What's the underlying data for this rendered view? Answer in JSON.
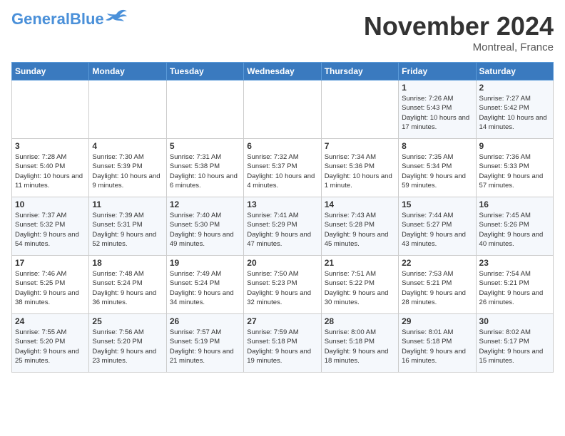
{
  "header": {
    "logo_general": "General",
    "logo_blue": "Blue",
    "month_title": "November 2024",
    "location": "Montreal, France"
  },
  "days_of_week": [
    "Sunday",
    "Monday",
    "Tuesday",
    "Wednesday",
    "Thursday",
    "Friday",
    "Saturday"
  ],
  "weeks": [
    [
      {
        "day": "",
        "info": ""
      },
      {
        "day": "",
        "info": ""
      },
      {
        "day": "",
        "info": ""
      },
      {
        "day": "",
        "info": ""
      },
      {
        "day": "",
        "info": ""
      },
      {
        "day": "1",
        "info": "Sunrise: 7:26 AM\nSunset: 5:43 PM\nDaylight: 10 hours and 17 minutes."
      },
      {
        "day": "2",
        "info": "Sunrise: 7:27 AM\nSunset: 5:42 PM\nDaylight: 10 hours and 14 minutes."
      }
    ],
    [
      {
        "day": "3",
        "info": "Sunrise: 7:28 AM\nSunset: 5:40 PM\nDaylight: 10 hours and 11 minutes."
      },
      {
        "day": "4",
        "info": "Sunrise: 7:30 AM\nSunset: 5:39 PM\nDaylight: 10 hours and 9 minutes."
      },
      {
        "day": "5",
        "info": "Sunrise: 7:31 AM\nSunset: 5:38 PM\nDaylight: 10 hours and 6 minutes."
      },
      {
        "day": "6",
        "info": "Sunrise: 7:32 AM\nSunset: 5:37 PM\nDaylight: 10 hours and 4 minutes."
      },
      {
        "day": "7",
        "info": "Sunrise: 7:34 AM\nSunset: 5:36 PM\nDaylight: 10 hours and 1 minute."
      },
      {
        "day": "8",
        "info": "Sunrise: 7:35 AM\nSunset: 5:34 PM\nDaylight: 9 hours and 59 minutes."
      },
      {
        "day": "9",
        "info": "Sunrise: 7:36 AM\nSunset: 5:33 PM\nDaylight: 9 hours and 57 minutes."
      }
    ],
    [
      {
        "day": "10",
        "info": "Sunrise: 7:37 AM\nSunset: 5:32 PM\nDaylight: 9 hours and 54 minutes."
      },
      {
        "day": "11",
        "info": "Sunrise: 7:39 AM\nSunset: 5:31 PM\nDaylight: 9 hours and 52 minutes."
      },
      {
        "day": "12",
        "info": "Sunrise: 7:40 AM\nSunset: 5:30 PM\nDaylight: 9 hours and 49 minutes."
      },
      {
        "day": "13",
        "info": "Sunrise: 7:41 AM\nSunset: 5:29 PM\nDaylight: 9 hours and 47 minutes."
      },
      {
        "day": "14",
        "info": "Sunrise: 7:43 AM\nSunset: 5:28 PM\nDaylight: 9 hours and 45 minutes."
      },
      {
        "day": "15",
        "info": "Sunrise: 7:44 AM\nSunset: 5:27 PM\nDaylight: 9 hours and 43 minutes."
      },
      {
        "day": "16",
        "info": "Sunrise: 7:45 AM\nSunset: 5:26 PM\nDaylight: 9 hours and 40 minutes."
      }
    ],
    [
      {
        "day": "17",
        "info": "Sunrise: 7:46 AM\nSunset: 5:25 PM\nDaylight: 9 hours and 38 minutes."
      },
      {
        "day": "18",
        "info": "Sunrise: 7:48 AM\nSunset: 5:24 PM\nDaylight: 9 hours and 36 minutes."
      },
      {
        "day": "19",
        "info": "Sunrise: 7:49 AM\nSunset: 5:24 PM\nDaylight: 9 hours and 34 minutes."
      },
      {
        "day": "20",
        "info": "Sunrise: 7:50 AM\nSunset: 5:23 PM\nDaylight: 9 hours and 32 minutes."
      },
      {
        "day": "21",
        "info": "Sunrise: 7:51 AM\nSunset: 5:22 PM\nDaylight: 9 hours and 30 minutes."
      },
      {
        "day": "22",
        "info": "Sunrise: 7:53 AM\nSunset: 5:21 PM\nDaylight: 9 hours and 28 minutes."
      },
      {
        "day": "23",
        "info": "Sunrise: 7:54 AM\nSunset: 5:21 PM\nDaylight: 9 hours and 26 minutes."
      }
    ],
    [
      {
        "day": "24",
        "info": "Sunrise: 7:55 AM\nSunset: 5:20 PM\nDaylight: 9 hours and 25 minutes."
      },
      {
        "day": "25",
        "info": "Sunrise: 7:56 AM\nSunset: 5:20 PM\nDaylight: 9 hours and 23 minutes."
      },
      {
        "day": "26",
        "info": "Sunrise: 7:57 AM\nSunset: 5:19 PM\nDaylight: 9 hours and 21 minutes."
      },
      {
        "day": "27",
        "info": "Sunrise: 7:59 AM\nSunset: 5:18 PM\nDaylight: 9 hours and 19 minutes."
      },
      {
        "day": "28",
        "info": "Sunrise: 8:00 AM\nSunset: 5:18 PM\nDaylight: 9 hours and 18 minutes."
      },
      {
        "day": "29",
        "info": "Sunrise: 8:01 AM\nSunset: 5:18 PM\nDaylight: 9 hours and 16 minutes."
      },
      {
        "day": "30",
        "info": "Sunrise: 8:02 AM\nSunset: 5:17 PM\nDaylight: 9 hours and 15 minutes."
      }
    ]
  ]
}
